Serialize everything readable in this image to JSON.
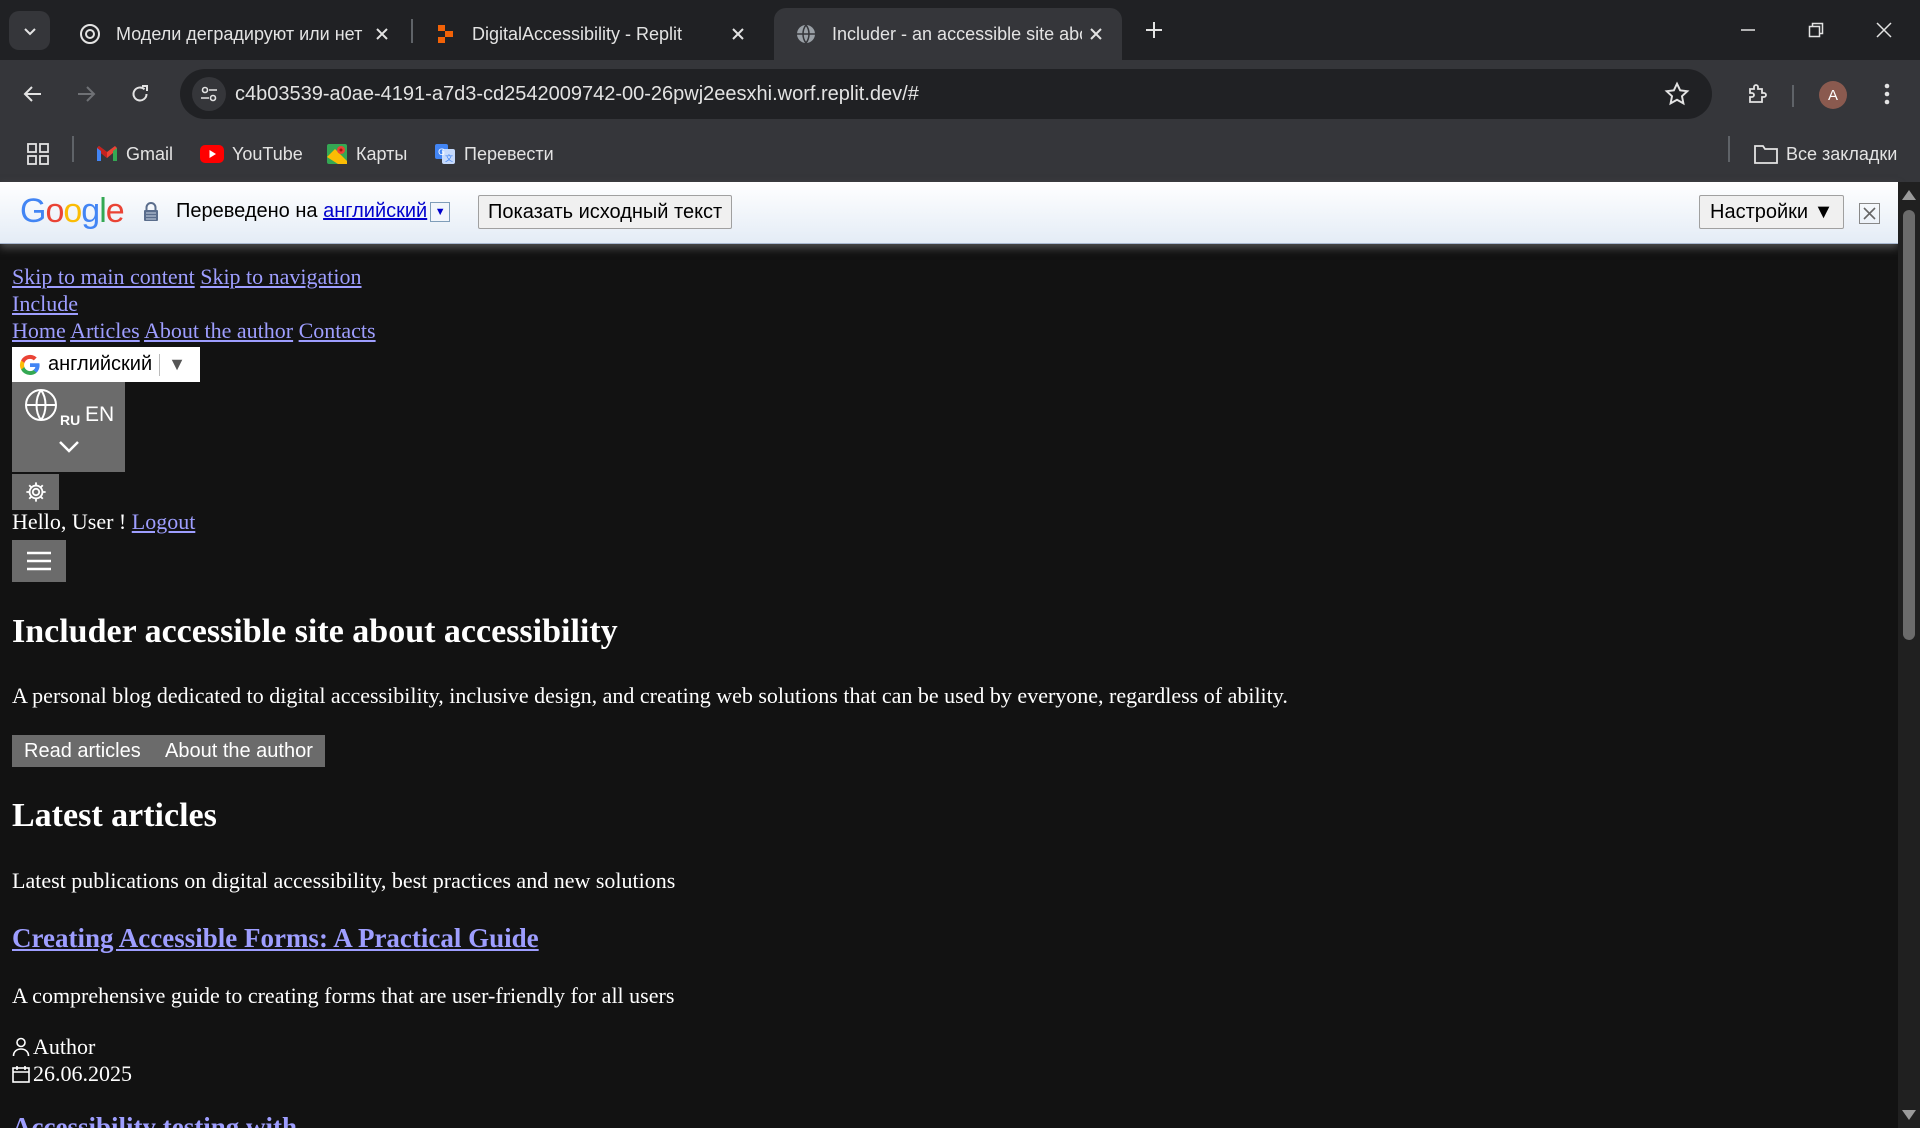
{
  "browser": {
    "tabs": [
      {
        "title": "Модели деградируют или нет",
        "favicon": "openai-icon",
        "active": false
      },
      {
        "title": "DigitalAccessibility - Replit",
        "favicon": "replit-icon",
        "active": false
      },
      {
        "title": "Includer - an accessible site abo",
        "favicon": "globe-icon",
        "active": true
      }
    ],
    "url": "c4b03539-a0ae-4191-a7d3-cd2542009742-00-26pwj2eesxhi.worf.replit.dev/#",
    "avatar_letter": "A",
    "bookmarks": [
      "Gmail",
      "YouTube",
      "Карты",
      "Перевести"
    ],
    "all_bookmarks": "Все закладки"
  },
  "translate_bar": {
    "logo": "Google",
    "translated_to": "Переведено на",
    "language": "английский",
    "show_original": "Показать исходный текст",
    "settings": "Настройки ▼"
  },
  "page": {
    "skip_main": "Skip to main content",
    "skip_nav": "Skip to navigation",
    "site_name": "Include",
    "nav": [
      "Home",
      "Articles",
      "About the author",
      "Contacts"
    ],
    "lang_select": "английский",
    "lang_switch": {
      "small": "RU",
      "big": "EN"
    },
    "greeting": "Hello, User !",
    "logout": "Logout",
    "hero_title": "Includer accessible site about accessibility",
    "hero_text": "A personal blog dedicated to digital accessibility, inclusive design, and creating web solutions that can be used by everyone, regardless of ability.",
    "cta_articles": "Read articles",
    "cta_author": "About the author",
    "latest_title": "Latest articles",
    "latest_text": "Latest publications on digital accessibility, best practices and new solutions",
    "article": {
      "title": "Creating Accessible Forms: A Practical Guide",
      "summary": "A comprehensive guide to creating forms that are user-friendly for all users",
      "author": "Author",
      "date": "26.06.2025"
    },
    "next_article_partial": "Accessibility testing with"
  },
  "colors": {
    "link": "#9e9eff",
    "page_bg": "#121212",
    "button_bg": "#6b6b6b"
  }
}
